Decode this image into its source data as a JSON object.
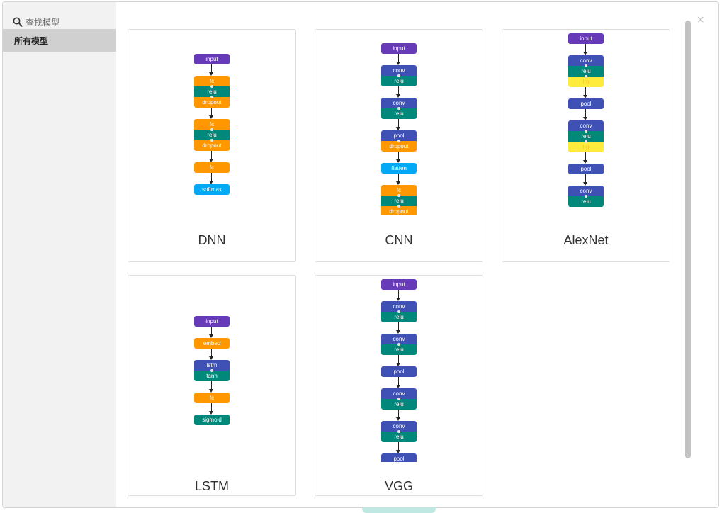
{
  "search": {
    "placeholder": "查找模型",
    "icon": "search-icon"
  },
  "sidebar": {
    "items": [
      {
        "label": "所有模型",
        "selected": true
      }
    ]
  },
  "close_glyph": "×",
  "colors": {
    "input": "#673ab7",
    "fc": "#ff9800",
    "relu": "#00897b",
    "dropout": "#ff9800",
    "softmax": "#03a9f4",
    "conv": "#3f51b5",
    "pool": "#3f51b5",
    "flatten": "#03a9f4",
    "lrn": "#ffeb3b",
    "embed": "#ff9800",
    "lstm": "#3f51b5",
    "tanh": "#00897b",
    "sigmoid": "#00897b"
  },
  "cards": [
    {
      "title": "DNN",
      "groups": [
        [
          "input"
        ],
        [
          "fc",
          "relu",
          "dropout"
        ],
        [
          "fc",
          "relu",
          "dropout"
        ],
        [
          "fc"
        ],
        [
          "softmax"
        ]
      ]
    },
    {
      "title": "CNN",
      "groups": [
        [
          "input"
        ],
        [
          "conv",
          "relu"
        ],
        [
          "conv",
          "relu"
        ],
        [
          "pool",
          "dropout"
        ],
        [
          "flatten"
        ],
        [
          "fc",
          "relu",
          "dropout"
        ]
      ]
    },
    {
      "title": "AlexNet",
      "groups": [
        [
          "input"
        ],
        [
          "conv",
          "relu",
          "lrn"
        ],
        [
          "pool"
        ],
        [
          "conv",
          "relu",
          "lrn"
        ],
        [
          "pool"
        ],
        [
          "conv",
          "relu"
        ]
      ]
    },
    {
      "title": "LSTM",
      "groups": [
        [
          "input"
        ],
        [
          "embed"
        ],
        [
          "lstm",
          "tanh"
        ],
        [
          "fc"
        ],
        [
          "sigmoid"
        ]
      ]
    },
    {
      "title": "VGG",
      "groups": [
        [
          "input"
        ],
        [
          "conv",
          "relu"
        ],
        [
          "conv",
          "relu"
        ],
        [
          "pool"
        ],
        [
          "conv",
          "relu"
        ],
        [
          "conv",
          "relu"
        ],
        [
          "pool"
        ]
      ]
    }
  ]
}
